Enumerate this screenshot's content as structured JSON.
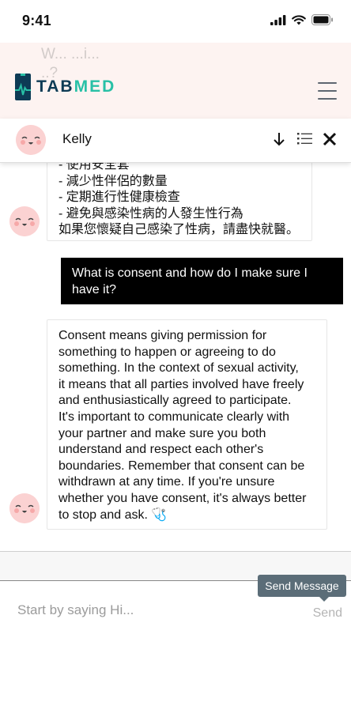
{
  "status_bar": {
    "time": "9:41"
  },
  "background_ghost": {
    "line1": "W...                        ...i...",
    "line2": "..?"
  },
  "app_header": {
    "logo_tab": "TAB",
    "logo_med": "MED"
  },
  "chat_header": {
    "name": "Kelly"
  },
  "messages": {
    "bot_1_lines": [
      "- 使用安全套",
      "- 減少性伴侶的數量",
      "- 定期進行性健康檢查",
      "- 避免與感染性病的人發生性行為",
      "如果您懷疑自己感染了性病，請盡快就醫。"
    ],
    "user_1": "What is consent and how do I make sure I have it?",
    "bot_2_lines": [
      "Consent means giving permission for",
      "something to happen or agreeing to do",
      "something. In the context of sexual activity,",
      "it means that all parties involved have freely",
      "and enthusiastically agreed to participate.",
      "It's important to communicate clearly with",
      "your partner and make sure you both",
      "understand and respect each other's",
      "boundaries. Remember that consent can be",
      "withdrawn at any time. If you're unsure",
      "whether you have consent, it's always better",
      "to stop and ask. 🩺"
    ]
  },
  "composer": {
    "placeholder": "Start by saying Hi...",
    "send_label": "Send",
    "tooltip": "Send Message"
  },
  "colors": {
    "brand_dark": "#0d3b55",
    "brand_teal": "#28c0a6",
    "user_bubble": "#000000",
    "avatar": "#fbd2d2",
    "tooltip": "#5b6d78"
  },
  "icons": [
    "signal-icon",
    "wifi-icon",
    "battery-icon",
    "logo-icon",
    "hamburger-menu-icon",
    "avatar-face-icon",
    "arrow-down-icon",
    "list-icon",
    "close-icon",
    "stethoscope-icon"
  ]
}
